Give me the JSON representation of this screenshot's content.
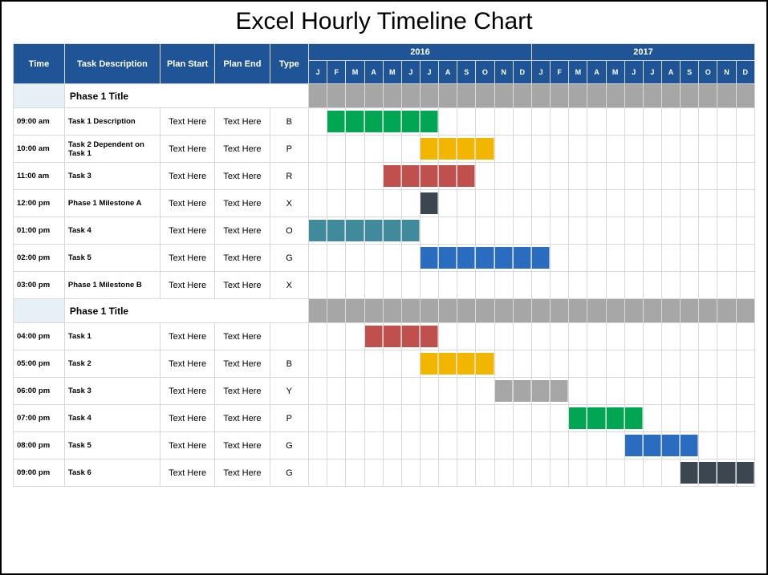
{
  "title": "Excel Hourly Timeline Chart",
  "headers": {
    "time": "Time",
    "desc": "Task Description",
    "start": "Plan Start",
    "end": "Plan End",
    "type": "Type",
    "years": [
      "2016",
      "2017"
    ],
    "months": [
      "J",
      "F",
      "M",
      "A",
      "M",
      "J",
      "J",
      "A",
      "S",
      "O",
      "N",
      "D",
      "J",
      "F",
      "M",
      "A",
      "M",
      "J",
      "J",
      "A",
      "S",
      "O",
      "N",
      "D"
    ]
  },
  "chart_data": {
    "type": "gantt",
    "x_categories": [
      "2016-J",
      "2016-F",
      "2016-M",
      "2016-A",
      "2016-M",
      "2016-J",
      "2016-J",
      "2016-A",
      "2016-S",
      "2016-O",
      "2016-N",
      "2016-D",
      "2017-J",
      "2017-F",
      "2017-M",
      "2017-A",
      "2017-M",
      "2017-J",
      "2017-J",
      "2017-A",
      "2017-S",
      "2017-O",
      "2017-N",
      "2017-D"
    ],
    "rows": [
      {
        "kind": "phase",
        "label": "Phase 1 Title",
        "start": 0,
        "end": 24
      },
      {
        "time": "09:00 am",
        "desc": "Task 1 Description",
        "plan_start": "Text Here",
        "plan_end": "Text Here",
        "type": "B",
        "start": 1,
        "end": 7,
        "color": "g-green"
      },
      {
        "time": "10:00 am",
        "desc": "Task 2 Dependent on Task 1",
        "plan_start": "Text Here",
        "plan_end": "Text Here",
        "type": "P",
        "start": 6,
        "end": 10,
        "color": "g-yellow"
      },
      {
        "time": "11:00 am",
        "desc": "Task 3",
        "plan_start": "Text Here",
        "plan_end": "Text Here",
        "type": "R",
        "start": 4,
        "end": 9,
        "color": "g-red"
      },
      {
        "time": "12:00 pm",
        "desc": "Phase 1 Milestone A",
        "plan_start": "Text Here",
        "plan_end": "Text Here",
        "type": "X",
        "start": 6,
        "end": 7,
        "color": "g-dark"
      },
      {
        "time": "01:00 pm",
        "desc": "Task 4",
        "plan_start": "Text Here",
        "plan_end": "Text Here",
        "type": "O",
        "start": 0,
        "end": 6,
        "color": "g-teal"
      },
      {
        "time": "02:00 pm",
        "desc": "Task 5",
        "plan_start": "Text Here",
        "plan_end": "Text Here",
        "type": "G",
        "start": 6,
        "end": 13,
        "color": "g-blue"
      },
      {
        "time": "03:00 pm",
        "desc": "Phase 1 Milestone B",
        "plan_start": "Text Here",
        "plan_end": "Text Here",
        "type": "X",
        "start": null,
        "end": null,
        "color": ""
      },
      {
        "kind": "phase",
        "label": "Phase 1 Title",
        "start": 0,
        "end": 24
      },
      {
        "time": "04:00 pm",
        "desc": "Task 1",
        "plan_start": "Text Here",
        "plan_end": "Text Here",
        "type": "",
        "start": 3,
        "end": 7,
        "color": "g-red"
      },
      {
        "time": "05:00 pm",
        "desc": "Task 2",
        "plan_start": "Text Here",
        "plan_end": "Text Here",
        "type": "B",
        "start": 6,
        "end": 10,
        "color": "g-yellow"
      },
      {
        "time": "06:00 pm",
        "desc": "Task 3",
        "plan_start": "Text Here",
        "plan_end": "Text Here",
        "type": "Y",
        "start": 10,
        "end": 14,
        "color": "g-gray"
      },
      {
        "time": "07:00 pm",
        "desc": "Task 4",
        "plan_start": "Text Here",
        "plan_end": "Text Here",
        "type": "P",
        "start": 14,
        "end": 18,
        "color": "g-green"
      },
      {
        "time": "08:00 pm",
        "desc": "Task 5",
        "plan_start": "Text Here",
        "plan_end": "Text Here",
        "type": "G",
        "start": 17,
        "end": 21,
        "color": "g-blue"
      },
      {
        "time": "09:00 pm",
        "desc": "Task 6",
        "plan_start": "Text Here",
        "plan_end": "Text Here",
        "type": "G",
        "start": 20,
        "end": 24,
        "color": "g-dark"
      }
    ]
  }
}
